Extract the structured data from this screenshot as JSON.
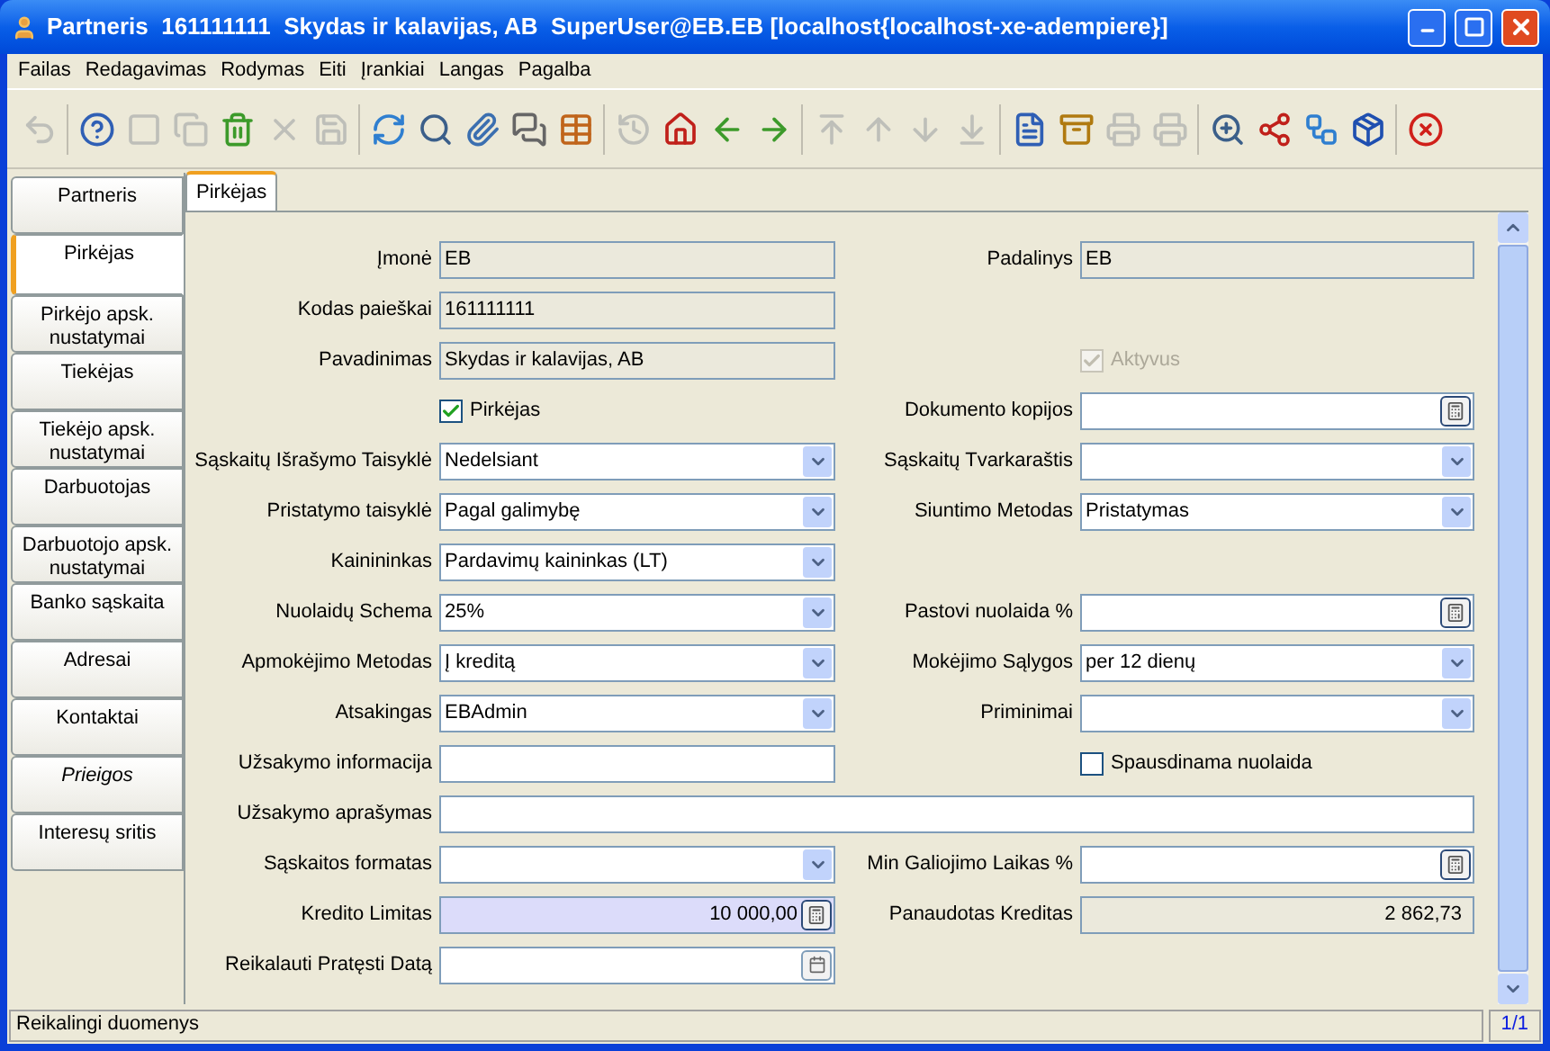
{
  "window": {
    "title": "Partneris  161111111  Skydas ir kalavijas, AB  SuperUser@EB.EB [localhost{localhost-xe-adempiere}]"
  },
  "menu": [
    "Failas",
    "Redagavimas",
    "Rodymas",
    "Eiti",
    "Įrankiai",
    "Langas",
    "Pagalba"
  ],
  "toolbar": [
    [
      {
        "kind": "undo",
        "disabled": true
      }
    ],
    [
      {
        "kind": "help",
        "disabled": false
      },
      {
        "kind": "new",
        "disabled": true
      },
      {
        "kind": "copy",
        "disabled": true
      },
      {
        "kind": "delete",
        "disabled": false
      },
      {
        "kind": "delete-selection",
        "disabled": true
      },
      {
        "kind": "save",
        "disabled": true
      }
    ],
    [
      {
        "kind": "refresh",
        "disabled": false
      },
      {
        "kind": "find",
        "disabled": false
      },
      {
        "kind": "attachment",
        "disabled": false
      },
      {
        "kind": "chat",
        "disabled": false
      },
      {
        "kind": "grid",
        "disabled": false
      }
    ],
    [
      {
        "kind": "history",
        "disabled": true
      },
      {
        "kind": "home",
        "disabled": false
      },
      {
        "kind": "back",
        "disabled": false
      },
      {
        "kind": "forward",
        "disabled": false
      }
    ],
    [
      {
        "kind": "first",
        "disabled": true
      },
      {
        "kind": "previous",
        "disabled": true
      },
      {
        "kind": "next",
        "disabled": true
      },
      {
        "kind": "last",
        "disabled": true
      }
    ],
    [
      {
        "kind": "report",
        "disabled": false
      },
      {
        "kind": "archive",
        "disabled": false
      },
      {
        "kind": "print",
        "disabled": true
      },
      {
        "kind": "print-preview",
        "disabled": true
      }
    ],
    [
      {
        "kind": "zoom-across",
        "disabled": false
      },
      {
        "kind": "request",
        "disabled": false
      },
      {
        "kind": "workflow",
        "disabled": false
      },
      {
        "kind": "product",
        "disabled": false
      }
    ],
    [
      {
        "kind": "exit",
        "disabled": false
      }
    ]
  ],
  "side_tabs": [
    {
      "label": "Partneris",
      "selected": false,
      "readonly": false
    },
    {
      "label": "Pirkėjas",
      "selected": true,
      "readonly": false
    },
    {
      "label": "Pirkėjo apsk. nustatymai",
      "selected": false,
      "readonly": false
    },
    {
      "label": "Tiekėjas",
      "selected": false,
      "readonly": false
    },
    {
      "label": "Tiekėjo apsk. nustatymai",
      "selected": false,
      "readonly": false
    },
    {
      "label": "Darbuotojas",
      "selected": false,
      "readonly": false
    },
    {
      "label": "Darbuotojo apsk. nustatymai",
      "selected": false,
      "readonly": false
    },
    {
      "label": "Banko sąskaita",
      "selected": false,
      "readonly": false
    },
    {
      "label": "Adresai",
      "selected": false,
      "readonly": false
    },
    {
      "label": "Kontaktai",
      "selected": false,
      "readonly": false
    },
    {
      "label": "Prieigos",
      "selected": false,
      "readonly": true
    },
    {
      "label": "Interesų sritis",
      "selected": false,
      "readonly": false
    }
  ],
  "top_tabs": [
    {
      "label": "Pirkėjas",
      "selected": true
    }
  ],
  "form": {
    "rows": [
      [
        {
          "kind": "readonly",
          "label": "Įmonė",
          "value": "EB"
        },
        {
          "kind": "readonly",
          "label": "Padalinys",
          "value": "EB"
        }
      ],
      [
        {
          "kind": "readonly",
          "label": "Kodas paieškai",
          "value": "161111111"
        }
      ],
      [
        {
          "kind": "readonly",
          "label": "Pavadinimas",
          "value": "Skydas ir kalavijas, AB"
        },
        {
          "kind": "checkbox",
          "label": "Aktyvus",
          "checked": true,
          "disabled": true
        }
      ],
      [
        {
          "kind": "checkbox",
          "label": "Pirkėjas",
          "checked": true,
          "disabled": false
        },
        {
          "kind": "amount",
          "label": "Dokumento kopijos",
          "mandatory": false
        }
      ],
      [
        {
          "kind": "combo",
          "label": "Sąskaitų Išrašymo Taisyklė",
          "value": "Nedelsiant"
        },
        {
          "kind": "combo",
          "label": "Sąskaitų Tvarkaraštis"
        }
      ],
      [
        {
          "kind": "combo",
          "label": "Pristatymo taisyklė",
          "value": "Pagal galimybę"
        },
        {
          "kind": "combo",
          "label": "Siuntimo Metodas",
          "value": "Pristatymas"
        }
      ],
      [
        {
          "kind": "combo",
          "label": "Kainininkas",
          "value": "Pardavimų kaininkas (LT)"
        }
      ],
      [
        {
          "kind": "combo",
          "label": "Nuolaidų Schema",
          "value": "25%"
        },
        {
          "kind": "amount",
          "label": "Pastovi nuolaida %",
          "mandatory": false
        }
      ],
      [
        {
          "kind": "combo",
          "label": "Apmokėjimo Metodas",
          "value": "Į kreditą"
        },
        {
          "kind": "combo",
          "label": "Mokėjimo Sąlygos",
          "value": "per 12 dienų"
        }
      ],
      [
        {
          "kind": "combo",
          "label": "Atsakingas",
          "value": "EBAdmin"
        },
        {
          "kind": "combo",
          "label": "Priminimai"
        }
      ],
      [
        {
          "kind": "text",
          "label": "Užsakymo informacija"
        },
        {
          "kind": "checkbox",
          "label": "Spausdinama nuolaida",
          "checked": false,
          "disabled": false
        }
      ],
      [
        {
          "kind": "wide-text",
          "label": "Užsakymo aprašymas"
        }
      ],
      [
        {
          "kind": "combo",
          "label": "Sąskaitos formatas"
        },
        {
          "kind": "amount",
          "label": "Min Galiojimo Laikas %",
          "mandatory": false
        }
      ],
      [
        {
          "kind": "amount",
          "label": "Kredito Limitas",
          "value": "10 000,00",
          "mandatory": true
        },
        {
          "kind": "readonly-amount",
          "label": "Panaudotas Kreditas",
          "value": "2 862,73"
        }
      ],
      [
        {
          "kind": "date",
          "label": "Reikalauti Pratęsti Datą"
        }
      ]
    ]
  },
  "status_bar": {
    "message": "Reikalingi duomenys",
    "record": "1/1"
  }
}
